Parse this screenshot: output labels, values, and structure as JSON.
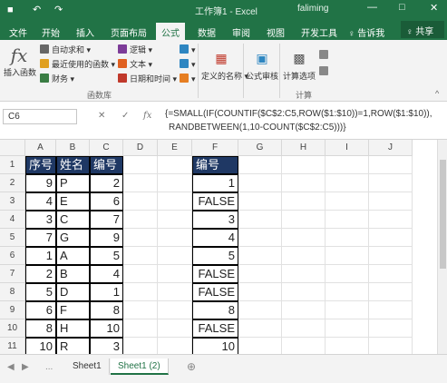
{
  "titlebar": {
    "title": "工作簿1 - Excel",
    "user": "faliming",
    "save_icon": "save-icon",
    "undo": "↶",
    "redo": "↷",
    "minimize": "—",
    "restore": "□",
    "close": "✕"
  },
  "tabs": [
    "文件",
    "开始",
    "插入",
    "页面布局",
    "公式",
    "数据",
    "审阅",
    "视图",
    "开发工具",
    "♀ 告诉我"
  ],
  "active_tab": "公式",
  "share": "♀ 共享",
  "ribbon": {
    "insert_function": "插入函数",
    "autosum": "自动求和",
    "recent": "最近使用的函数",
    "financial": "财务",
    "logical": "逻辑",
    "text": "文本",
    "datetime": "日期和时间",
    "library_label": "函数库",
    "defined_names": "定义的名称",
    "formula_audit": "公式审核",
    "calc_options": "计算选项",
    "calc_label": "计算"
  },
  "formulabar": {
    "namebox": "C6",
    "cancel": "✕",
    "enter": "✓",
    "fx": "fx",
    "formula_line1": "{=SMALL(IF(COUNTIF($C$2:C5,ROW($1:$10))=1,ROW($1:$10)),",
    "formula_line2": "RANDBETWEEN(1,10-COUNT($C$2:C5)))}"
  },
  "columns": [
    "A",
    "B",
    "C",
    "D",
    "E",
    "F",
    "G",
    "H",
    "I",
    "J"
  ],
  "rows": [
    "1",
    "2",
    "3",
    "4",
    "5",
    "6",
    "7",
    "8",
    "9",
    "10",
    "11"
  ],
  "table_left": {
    "headers": [
      "序号",
      "姓名",
      "编号"
    ],
    "rows": [
      [
        "9",
        "P",
        "2"
      ],
      [
        "4",
        "E",
        "6"
      ],
      [
        "3",
        "C",
        "7"
      ],
      [
        "7",
        "G",
        "9"
      ],
      [
        "1",
        "A",
        "5"
      ],
      [
        "2",
        "B",
        "4"
      ],
      [
        "5",
        "D",
        "1"
      ],
      [
        "6",
        "F",
        "8"
      ],
      [
        "8",
        "H",
        "10"
      ],
      [
        "10",
        "R",
        "3"
      ]
    ]
  },
  "table_right": {
    "header": "编号",
    "values": [
      "1",
      "FALSE",
      "3",
      "4",
      "5",
      "FALSE",
      "FALSE",
      "8",
      "FALSE",
      "10"
    ]
  },
  "sheets": {
    "nav_prev": "◀",
    "nav_next": "▶",
    "dots": "...",
    "tabs": [
      "Sheet1",
      "Sheet1 (2)"
    ],
    "active": "Sheet1 (2)",
    "add": "⊕"
  }
}
